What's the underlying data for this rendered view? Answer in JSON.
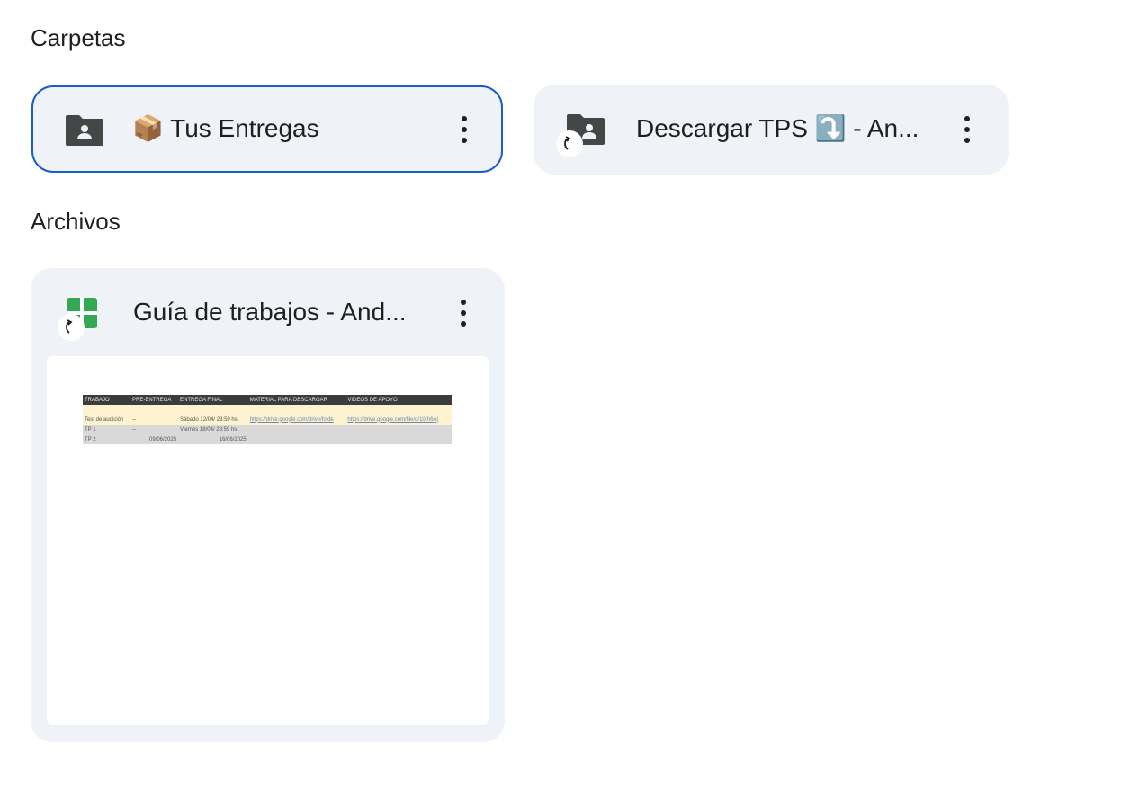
{
  "sections": {
    "folders_title": "Carpetas",
    "files_title": "Archivos"
  },
  "folders": [
    {
      "name": "📦 Tus Entregas",
      "icon": "shared-folder-icon",
      "shortcut": false,
      "selected": true
    },
    {
      "name": "Descargar TPS ⤵️ - An...",
      "icon": "shared-folder-icon",
      "shortcut": true,
      "selected": false
    }
  ],
  "files": [
    {
      "name": "Guía de trabajos - And...",
      "icon": "google-sheets-icon",
      "shortcut": true,
      "thumbnail": {
        "headers": [
          "TRABAJO",
          "PRE-ENTREGA",
          "ENTREGA FINAL",
          "MATERIAL PARA DESCARGAR",
          "VIDEOS DE APOYO"
        ],
        "rows": [
          [
            "",
            "",
            "",
            "",
            ""
          ],
          [
            "Test de audición",
            "--",
            "Sábado 12/04/ 23:59 hs.",
            "https://drive.google.com/drive/folde",
            "https://drive.google.com/file/d/1lXh6A("
          ],
          [
            "TP 1",
            "--",
            "Viernes 18/04/ 23:59 hs.",
            "",
            ""
          ],
          [
            "TP 2",
            "09/06/2025",
            "16/06/2025",
            "",
            ""
          ]
        ]
      }
    }
  ],
  "colors": {
    "card_bg": "#eff2f7",
    "selected_border": "#1a5dc8",
    "sheets_green": "#34a853",
    "icon_dark": "#444746"
  }
}
